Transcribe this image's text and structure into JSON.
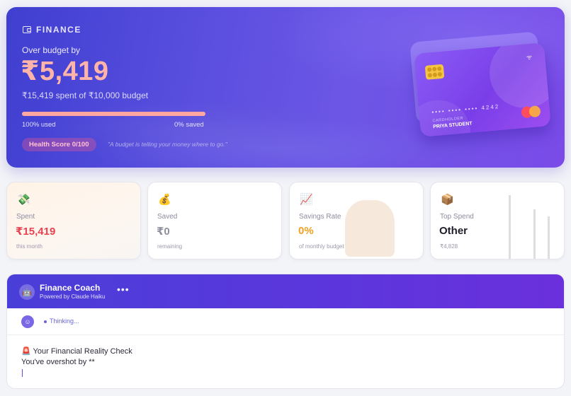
{
  "hero": {
    "brand": "FINANCE",
    "label": "Over budget by",
    "amount": "₹5,419",
    "summary": "₹15,419 spent of ₹10,000 budget",
    "progress": 1.0,
    "used_text": "100% used",
    "saved_text": "0% saved",
    "health_badge": "Health Score 0/100",
    "quote": "\"A budget is telling your money where to go.\""
  },
  "card": {
    "number": "•••• •••• •••• 4242",
    "holder_label": "CARDHOLDER",
    "holder_name": "PRIYA STUDENT"
  },
  "stats": [
    {
      "emoji": "💸",
      "title": "Spent",
      "value": "₹15,419",
      "note": "this month",
      "color": "#e8424f"
    },
    {
      "emoji": "💰",
      "title": "Saved",
      "value": "₹0",
      "note": "remaining",
      "color": "#8f8f9d"
    },
    {
      "emoji": "📈",
      "title": "Savings Rate",
      "value": "0%",
      "note": "of monthly budget",
      "color": "#f0a020"
    },
    {
      "emoji": "📦",
      "title": "Top Spend",
      "value": "Other",
      "note": "₹4,828",
      "color": "#1d1d2b"
    }
  ],
  "coach": {
    "title": "Finance Coach",
    "subtitle": "Powered by Claude Haiku",
    "menu": "•••",
    "thinking": "Thinking...",
    "line1": "🚨 Your Financial Reality Check",
    "line2": "You've overshot by **"
  }
}
